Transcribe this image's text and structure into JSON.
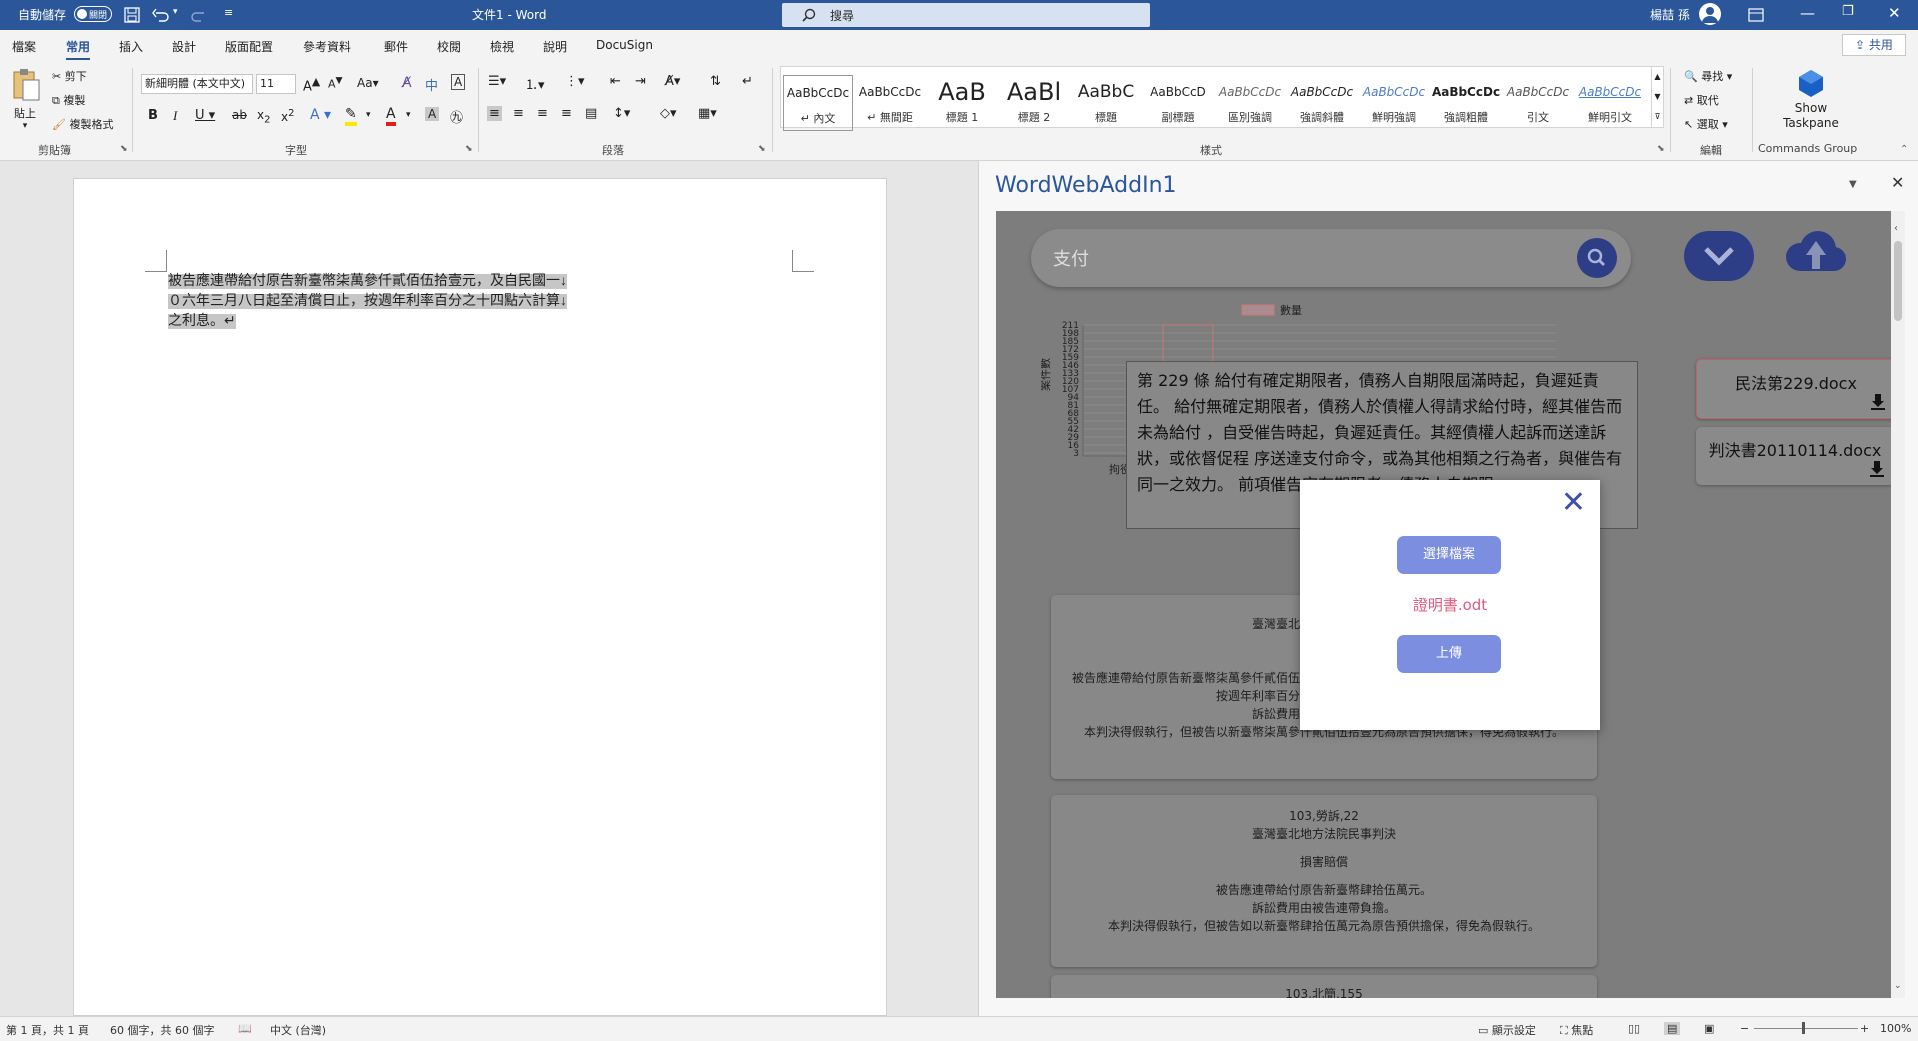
{
  "titlebar": {
    "autosave_label": "自動儲存",
    "autosave_state": "關閉",
    "doc_title": "文件1 - Word",
    "search_placeholder": "搜尋",
    "user_name": "楊喆 孫",
    "bg_color": "#2b579a"
  },
  "tabs": [
    "檔案",
    "常用",
    "插入",
    "設計",
    "版面配置",
    "參考資料",
    "郵件",
    "校閱",
    "檢視",
    "說明",
    "DocuSign"
  ],
  "active_tab": "常用",
  "share_label": "共用",
  "ribbon": {
    "clipboard": {
      "paste": "貼上",
      "cut": "剪下",
      "copy": "複製",
      "format_painter": "複製格式",
      "group_label": "剪貼簿"
    },
    "font": {
      "font_name": "新細明體 (本文中文)",
      "font_size": "11",
      "change_case": "Aa",
      "group_label": "字型"
    },
    "paragraph": {
      "group_label": "段落"
    },
    "styles": {
      "group_label": "樣式",
      "items": [
        {
          "preview": "AaBbCcDc",
          "name": "↵ 內文"
        },
        {
          "preview": "AaBbCcDc",
          "name": "↵ 無間距"
        },
        {
          "preview": "AaB",
          "name": "標題 1"
        },
        {
          "preview": "AaBl",
          "name": "標題 2"
        },
        {
          "preview": "AaBbC",
          "name": "標題"
        },
        {
          "preview": "AaBbCcD",
          "name": "副標題"
        },
        {
          "preview": "AaBbCcDc",
          "name": "區別強調"
        },
        {
          "preview": "AaBbCcDc",
          "name": "強調斜體"
        },
        {
          "preview": "AaBbCcDc",
          "name": "鮮明強調"
        },
        {
          "preview": "AaBbCcDc",
          "name": "強調粗體"
        },
        {
          "preview": "AaBbCcDc",
          "name": "引文"
        },
        {
          "preview": "AaBbCcDc",
          "name": "鮮明引文"
        }
      ]
    },
    "editing": {
      "find": "尋找",
      "replace": "取代",
      "select": "選取",
      "group_label": "編輯"
    },
    "commands": {
      "show_taskpane": "Show Taskpane",
      "group_label": "Commands Group"
    }
  },
  "document": {
    "lines": [
      "被告應連帶給付原告新臺幣柒萬參仟貳佰伍拾壹元，及自民國一↓",
      "０六年三月八日起至清償日止，按週年利率百分之十四點六計算↓",
      "之利息。↵"
    ]
  },
  "taskpane": {
    "title": "WordWebAddIn1",
    "search_query": "支付",
    "chart": {
      "legend": "數量",
      "ylabel": "案件數",
      "xlabel_first": "拘役",
      "yticks": [
        "211",
        "198",
        "185",
        "172",
        "159",
        "146",
        "133",
        "120",
        "107",
        "94",
        "81",
        "68",
        "55",
        "42",
        "29",
        "16",
        "3"
      ]
    },
    "article_text": "第 229 條 給付有確定期限者，債務人自期限屆滿時起，負遲延責任。 給付無確定期限者，債務人於債權人得請求給付時，經其催告而未為給付 ，自受催告時起，負遲延責任。其經債權人起訴而送達訴狀，或依督促程 序送達支付命令，或為其他相類之行為者，與催告有同一之效力。 前項催告定有期限者，債務人自期限",
    "files": [
      {
        "name": "民法第229.docx"
      },
      {
        "name": "判決書20110114.docx"
      }
    ],
    "cards": [
      {
        "lines": [
          "臺灣臺北地方法院民事判決",
          "",
          "",
          "被告應連帶給付原告新臺幣柒萬參仟貳佰伍拾壹元，及自民國一０六年三月八日起至清償日止，按週年利率百分之十四點六計算之利息。",
          "訴訟費用由被告連帶負擔。",
          "本判決得假執行，但被告以新臺幣柒萬參仟貳佰伍拾壹元為原告預供擔保，得免為假執行。"
        ]
      },
      {
        "lines": [
          "103,勞訴,22",
          "臺灣臺北地方法院民事判決",
          "",
          "損害賠償",
          "",
          "被告應連帶給付原告新臺幣肆拾伍萬元。",
          "訴訟費用由被告連帶負擔。",
          "本判決得假執行，但被告如以新臺幣肆拾伍萬元為原告預供擔保，得免為假執行。"
        ]
      },
      {
        "lines": [
          "103,北簡,155"
        ]
      }
    ],
    "modal": {
      "choose_file": "選擇檔案",
      "file_name": "證明書.odt",
      "upload": "上傳"
    }
  },
  "statusbar": {
    "page": "第 1 頁，共 1 頁",
    "words": "60 個字，共 60 個字",
    "language": "中文 (台灣)",
    "display_settings": "顯示設定",
    "focus": "焦點",
    "zoom": "100%"
  },
  "colors": {
    "accent": "#2b579a",
    "addin_primary": "#2d3e87",
    "modal_button": "#7b8ee0",
    "file_name": "#e05a7d"
  }
}
